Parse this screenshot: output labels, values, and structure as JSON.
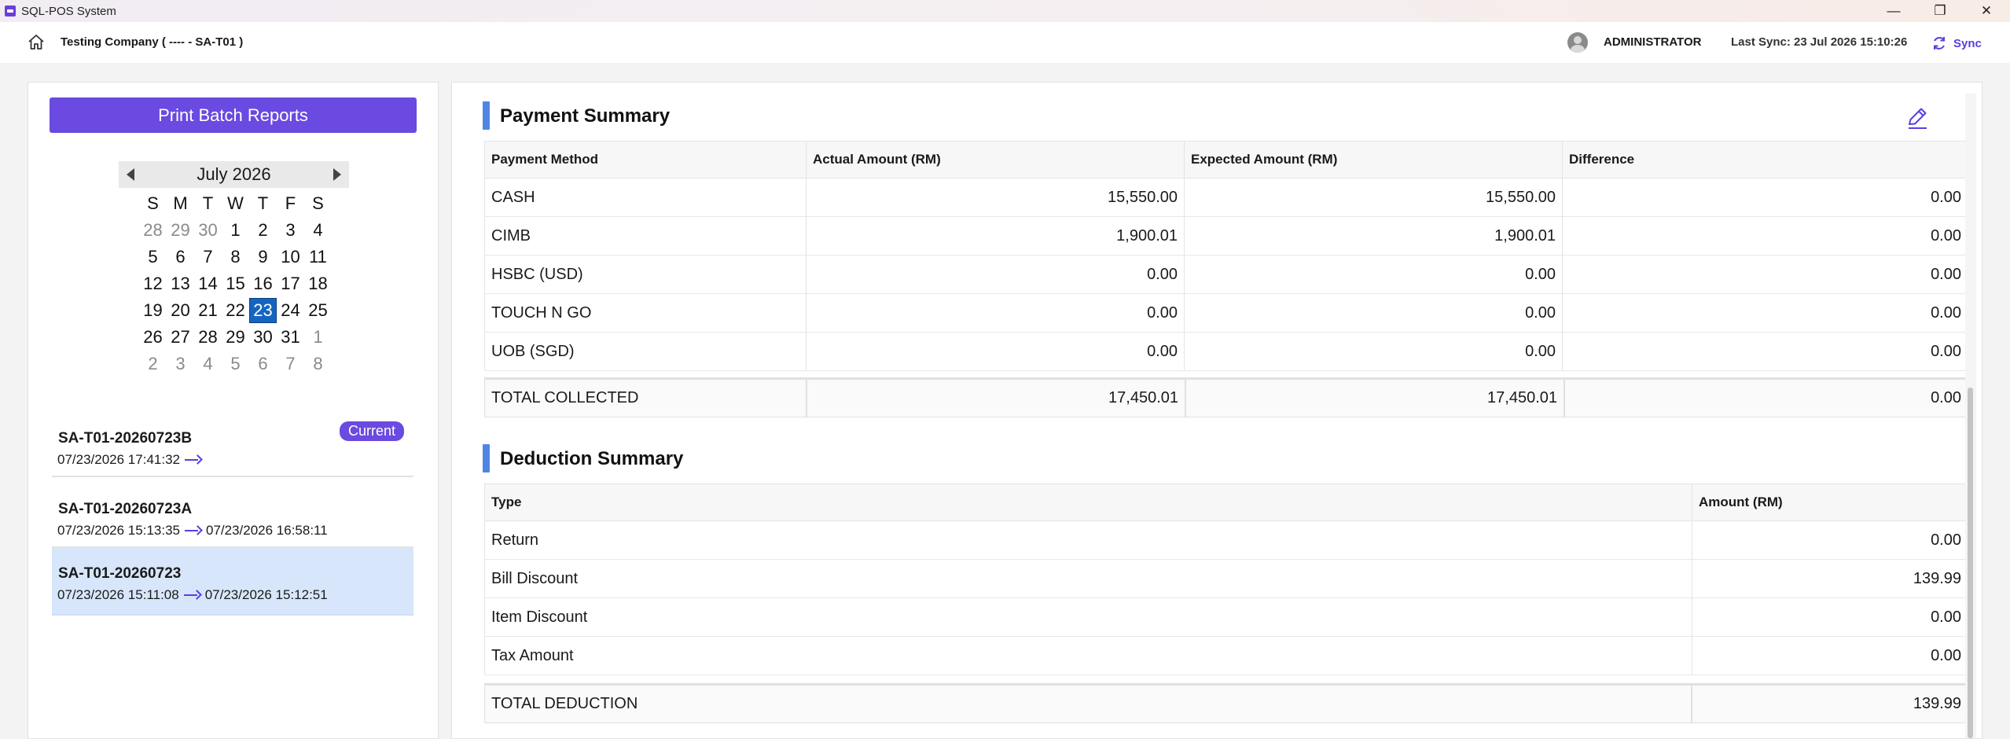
{
  "window": {
    "title": "SQL-POS System",
    "minimize_glyph": "—",
    "maximize_glyph": "❐",
    "close_glyph": "✕"
  },
  "header": {
    "company": "Testing Company ( ---- - SA-T01 )",
    "user": "ADMINISTRATOR",
    "last_sync": "Last Sync: 23 Jul 2026 15:10:26",
    "sync_label": "Sync",
    "accent": "#5a3ee0"
  },
  "sidebar": {
    "print_button": "Print Batch Reports",
    "calendar": {
      "month_label": "July 2026",
      "weekdays": [
        "S",
        "M",
        "T",
        "W",
        "T",
        "F",
        "S"
      ],
      "weeks": [
        [
          [
            "28",
            1
          ],
          [
            "29",
            1
          ],
          [
            "30",
            1
          ],
          [
            "1",
            0
          ],
          [
            "2",
            0
          ],
          [
            "3",
            0
          ],
          [
            "4",
            0
          ]
        ],
        [
          [
            "5",
            0
          ],
          [
            "6",
            0
          ],
          [
            "7",
            0
          ],
          [
            "8",
            0
          ],
          [
            "9",
            0
          ],
          [
            "10",
            0
          ],
          [
            "11",
            0
          ]
        ],
        [
          [
            "12",
            0
          ],
          [
            "13",
            0
          ],
          [
            "14",
            0
          ],
          [
            "15",
            0
          ],
          [
            "16",
            0
          ],
          [
            "17",
            0
          ],
          [
            "18",
            0
          ]
        ],
        [
          [
            "19",
            0
          ],
          [
            "20",
            0
          ],
          [
            "21",
            0
          ],
          [
            "22",
            0
          ],
          [
            "23",
            2
          ],
          [
            "24",
            0
          ],
          [
            "25",
            0
          ]
        ],
        [
          [
            "26",
            0
          ],
          [
            "27",
            0
          ],
          [
            "28",
            0
          ],
          [
            "29",
            0
          ],
          [
            "30",
            0
          ],
          [
            "31",
            0
          ],
          [
            "1",
            1
          ]
        ],
        [
          [
            "2",
            1
          ],
          [
            "3",
            1
          ],
          [
            "4",
            1
          ],
          [
            "5",
            1
          ],
          [
            "6",
            1
          ],
          [
            "7",
            1
          ],
          [
            "8",
            1
          ]
        ]
      ],
      "selected_day": "23"
    },
    "batches": [
      {
        "id": "SA-T01-20260723B",
        "start": "07/23/2026 17:41:32",
        "end": "",
        "badge": "Current"
      },
      {
        "id": "SA-T01-20260723A",
        "start": "07/23/2026 15:13:35",
        "end": "07/23/2026 16:58:11",
        "badge": ""
      },
      {
        "id": "SA-T01-20260723",
        "start": "07/23/2026 15:11:08",
        "end": "07/23/2026 15:12:51",
        "badge": ""
      }
    ]
  },
  "payment_summary": {
    "title": "Payment Summary",
    "columns": [
      "Payment Method",
      "Actual Amount (RM)",
      "Expected Amount (RM)",
      "Difference"
    ],
    "rows": [
      [
        "CASH",
        "15,550.00",
        "15,550.00",
        "0.00"
      ],
      [
        "CIMB",
        "1,900.01",
        "1,900.01",
        "0.00"
      ],
      [
        "HSBC (USD)",
        "0.00",
        "0.00",
        "0.00"
      ],
      [
        "TOUCH N GO",
        "0.00",
        "0.00",
        "0.00"
      ],
      [
        "UOB (SGD)",
        "0.00",
        "0.00",
        "0.00"
      ]
    ],
    "total": [
      "TOTAL COLLECTED",
      "17,450.01",
      "17,450.01",
      "0.00"
    ]
  },
  "deduction_summary": {
    "title": "Deduction Summary",
    "columns": [
      "Type",
      "Amount (RM)"
    ],
    "rows": [
      [
        "Return",
        "0.00"
      ],
      [
        "Bill Discount",
        "139.99"
      ],
      [
        "Item Discount",
        "0.00"
      ],
      [
        "Tax Amount",
        "0.00"
      ]
    ],
    "total": [
      "TOTAL DEDUCTION",
      "139.99"
    ]
  },
  "colors": {
    "primary": "#6a4ae0",
    "section_bar": "#4f86e6",
    "selected_day": "#1565c0",
    "selected_batch_bg": "#d7e6fa"
  }
}
